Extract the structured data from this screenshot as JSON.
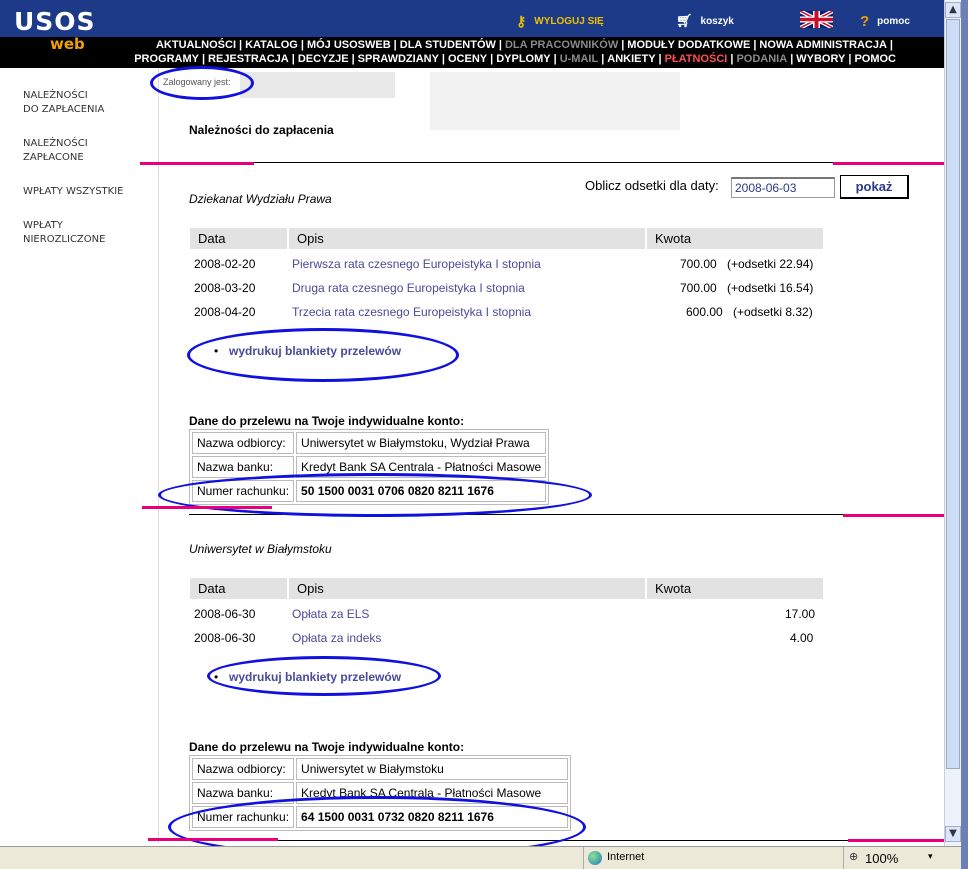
{
  "header": {
    "logo_main": "USOS",
    "logo_sub": "web",
    "logout_label": "WYLOGUJ SIĘ",
    "cart_label": "koszyk",
    "help_label": "pomoc"
  },
  "nav": {
    "row1": [
      {
        "label": "AKTUALNOŚCI",
        "state": "normal"
      },
      {
        "label": "KATALOG",
        "state": "normal"
      },
      {
        "label": "MÓJ USOSWEB",
        "state": "normal"
      },
      {
        "label": "DLA STUDENTÓW",
        "state": "normal"
      },
      {
        "label": "DLA PRACOWNIKÓW",
        "state": "dim"
      },
      {
        "label": "MODUŁY DODATKOWE",
        "state": "normal"
      },
      {
        "label": "NOWA ADMINISTRACJA",
        "state": "normal"
      }
    ],
    "row2": [
      {
        "label": "PROGRAMY",
        "state": "normal"
      },
      {
        "label": "REJESTRACJA",
        "state": "normal"
      },
      {
        "label": "DECYZJE",
        "state": "normal"
      },
      {
        "label": "SPRAWDZIANY",
        "state": "normal"
      },
      {
        "label": "OCENY",
        "state": "normal"
      },
      {
        "label": "DYPLOMY",
        "state": "normal"
      },
      {
        "label": "U-MAIL",
        "state": "dim"
      },
      {
        "label": "ANKIETY",
        "state": "normal"
      },
      {
        "label": "PŁATNOŚCI",
        "state": "active"
      },
      {
        "label": "PODANIA",
        "state": "dim"
      },
      {
        "label": "WYBORY",
        "state": "normal"
      },
      {
        "label": "POMOC",
        "state": "normal"
      }
    ]
  },
  "sidebar": {
    "items": [
      {
        "line1": "NALEŻNOŚCI",
        "line2": "DO ZAPŁACENIA"
      },
      {
        "line1": "NALEŻNOŚCI",
        "line2": "ZAPŁACONE"
      },
      {
        "line1": "WPŁATY WSZYSTKIE",
        "line2": ""
      },
      {
        "line1": "WPŁATY",
        "line2": "NIEROZLICZONE"
      }
    ]
  },
  "main": {
    "logged_in": "Zalogowany jest:",
    "title": "Należności do zapłacenia",
    "interest_label": "Oblicz odsetki dla daty:",
    "interest_date": "2008-06-03",
    "show_button": "pokaż",
    "columns": {
      "date": "Data",
      "desc": "Opis",
      "amount": "Kwota"
    },
    "sections": [
      {
        "name": "Dziekanat Wydziału Prawa",
        "rows": [
          {
            "date": "2008-02-20",
            "desc": "Pierwsza rata czesnego Europeistyka I stopnia",
            "amount": "700.00",
            "interest": "(+odsetki 22.94)"
          },
          {
            "date": "2008-03-20",
            "desc": "Druga rata czesnego Europeistyka I stopnia",
            "amount": "700.00",
            "interest": "(+odsetki 16.54)"
          },
          {
            "date": "2008-04-20",
            "desc": "Trzecia rata czesnego Europeistyka I stopnia",
            "amount": "600.00",
            "interest": "(+odsetki 8.32)"
          }
        ],
        "print_link": "wydrukuj blankiety przelewów",
        "transfer_heading": "Dane do przelewu na Twoje indywidualne konto:",
        "recipient_label": "Nazwa odbiorcy:",
        "recipient": "Uniwersytet w Białymstoku, Wydział Prawa",
        "bank_label": "Nazwa banku:",
        "bank": "Kredyt Bank SA Centrala - Płatności Masowe",
        "account_label": "Numer rachunku:",
        "account": "50 1500 0031 0706 0820 8211 1676"
      },
      {
        "name": "Uniwersytet w Białymstoku",
        "rows": [
          {
            "date": "2008-06-30",
            "desc": "Opłata za ELS",
            "amount": "17.00",
            "interest": ""
          },
          {
            "date": "2008-06-30",
            "desc": "Opłata za indeks",
            "amount": "4.00",
            "interest": ""
          }
        ],
        "print_link": "wydrukuj blankiety przelewów",
        "transfer_heading": "Dane do przelewu na Twoje indywidualne konto:",
        "recipient_label": "Nazwa odbiorcy:",
        "recipient": "Uniwersytet w Białymstoku",
        "bank_label": "Nazwa banku:",
        "bank": "Kredyt Bank SA Centrala - Płatności Masowe",
        "account_label": "Numer rachunku:",
        "account": "64 1500 0031 0732 0820 8211 1676"
      }
    ]
  },
  "statusbar": {
    "zone": "Internet",
    "zoom": "100%"
  },
  "colors": {
    "header_blue": "#1c3a87",
    "logo_accent": "#f0a000",
    "active_nav": "#ff4f4f",
    "link": "#4a4a9a",
    "annotation_ellipse": "#1010e0",
    "annotation_line": "#e8007a"
  }
}
